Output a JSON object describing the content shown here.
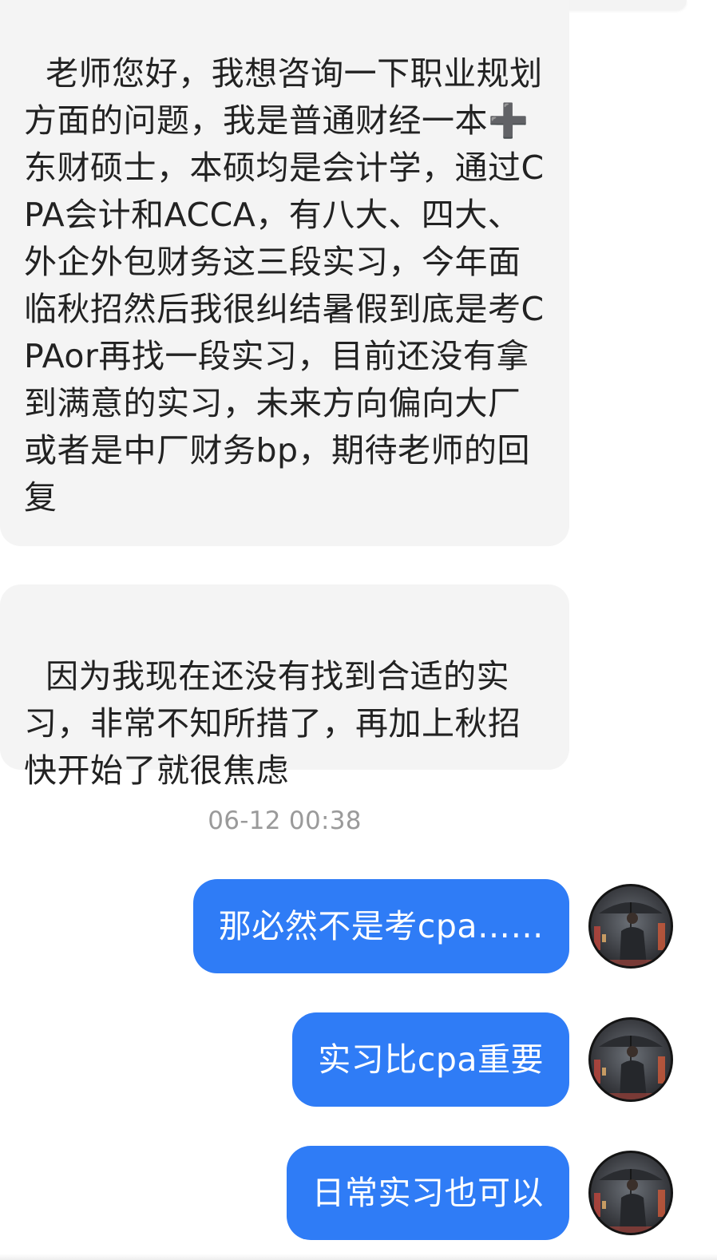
{
  "messages": {
    "incoming_1": "老师您好，我想咨询一下职业规划方面的问题，我是普通财经一本➕东财硕士，本硕均是会计学，通过CPA会计和ACCA，有八大、四大、外企外包财务这三段实习，今年面临秋招然后我很纠结暑假到底是考CPAor再找一段实习，目前还没有拿到满意的实习，未来方向偏向大厂或者是中厂财务bp，期待老师的回复",
    "incoming_2": "因为我现在还没有找到合适的实习，非常不知所措了，再加上秋招快开始了就很焦虑",
    "timestamp": "06-12 00:38",
    "outgoing_1": "那必然不是考cpa……",
    "outgoing_2": "实习比cpa重要",
    "outgoing_3": "日常实习也可以"
  },
  "colors": {
    "incoming_bubble": "#f4f4f4",
    "outgoing_bubble": "#2f7cf6",
    "timestamp_text": "#9a9a9a"
  },
  "icons": {
    "avatar": "man-with-umbrella-avatar"
  }
}
